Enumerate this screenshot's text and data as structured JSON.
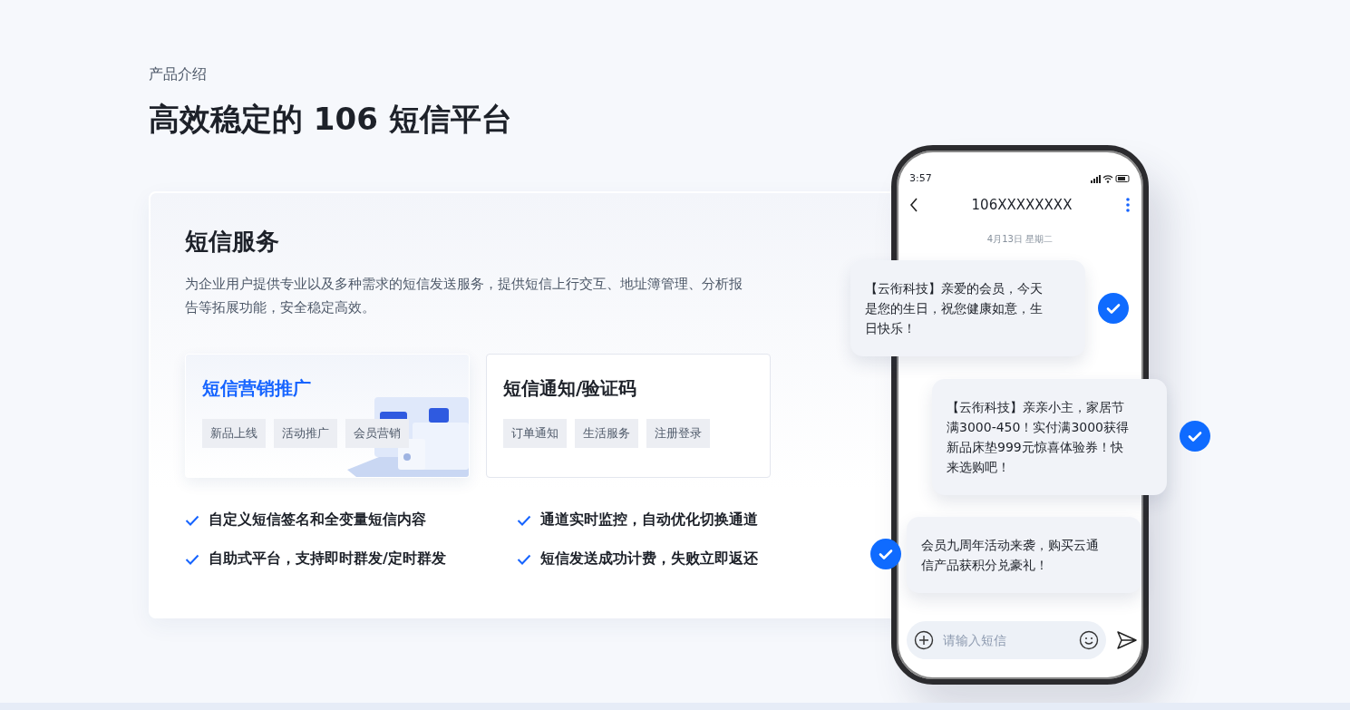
{
  "eyebrow": "产品介绍",
  "title": "高效稳定的 106 短信平台",
  "service": {
    "title": "短信服务",
    "description": "为企业用户提供专业以及多种需求的短信发送服务，提供短信上行交互、地址簿管理、分析报告等拓展功能，安全稳定高效。",
    "options": [
      {
        "title": "短信营销推广",
        "selected": true,
        "tags": [
          "新品上线",
          "活动推广",
          "会员营销"
        ]
      },
      {
        "title": "短信通知/验证码",
        "selected": false,
        "tags": [
          "订单通知",
          "生活服务",
          "注册登录"
        ]
      }
    ],
    "features": [
      "自定义短信签名和全变量短信内容",
      "通道实时监控，自动优化切换通道",
      "自助式平台，支持即时群发/定时群发",
      "短信发送成功计费，失败立即返还"
    ]
  },
  "phone": {
    "time": "3:57",
    "contact": "106XXXXXXXX",
    "date": "4月13日 星期二",
    "messages": [
      {
        "text": "【云衔科技】亲爱的会员，今天是您的生日，祝您健康如意，生日快乐！",
        "kind": "right"
      },
      {
        "text": "【云衔科技】亲亲小主，家居节满3000-450！实付满3000获得新品床垫999元惊喜体验券！快来选购吧！",
        "kind": "right"
      },
      {
        "text": "会员九周年活动来袭，购买云通信产品获积分兑豪礼！",
        "kind": "left"
      }
    ],
    "input": {
      "placeholder": "请输入短信"
    }
  }
}
